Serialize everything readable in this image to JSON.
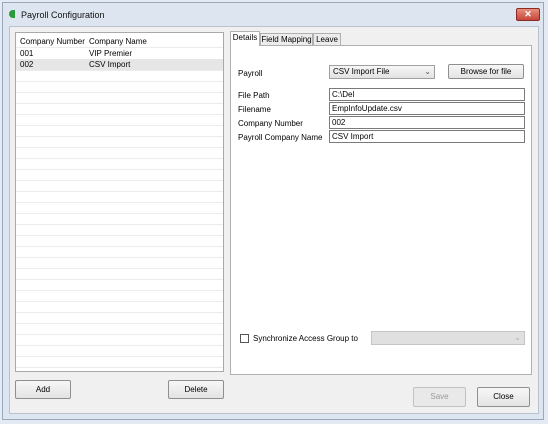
{
  "window": {
    "title": "Payroll Configuration",
    "close_glyph": "✕"
  },
  "list": {
    "columns": [
      "Company Number",
      "Company Name"
    ],
    "rows": [
      {
        "number": "001",
        "name": "VIP Premier"
      },
      {
        "number": "002",
        "name": "CSV Import"
      }
    ],
    "selected_index": 1
  },
  "buttons": {
    "add": "Add",
    "delete": "Delete",
    "save": "Save",
    "close": "Close"
  },
  "tabs": [
    "Details",
    "Field Mapping",
    "Leave"
  ],
  "active_tab": "Details",
  "details": {
    "payroll_label": "Payroll",
    "payroll_value": "CSV Import File",
    "browse_label": "Browse for file",
    "file_path_label": "File Path",
    "file_path_value": "C:\\Del",
    "filename_label": "Filename",
    "filename_value": "EmpInfoUpdate.csv",
    "company_number_label": "Company Number",
    "company_number_value": "002",
    "payroll_company_name_label": "Payroll Company Name",
    "payroll_company_name_value": "CSV Import",
    "sync_label": "Synchronize Access Group to",
    "sync_checked": false,
    "sync_value": ""
  },
  "icons": {
    "app": "payroll-app-icon",
    "dropdown": "chevron-down-icon"
  },
  "colors": {
    "window_bg": "#dde5f0",
    "close_button": "#c4473a",
    "selected_row": "#e6e6e6"
  }
}
